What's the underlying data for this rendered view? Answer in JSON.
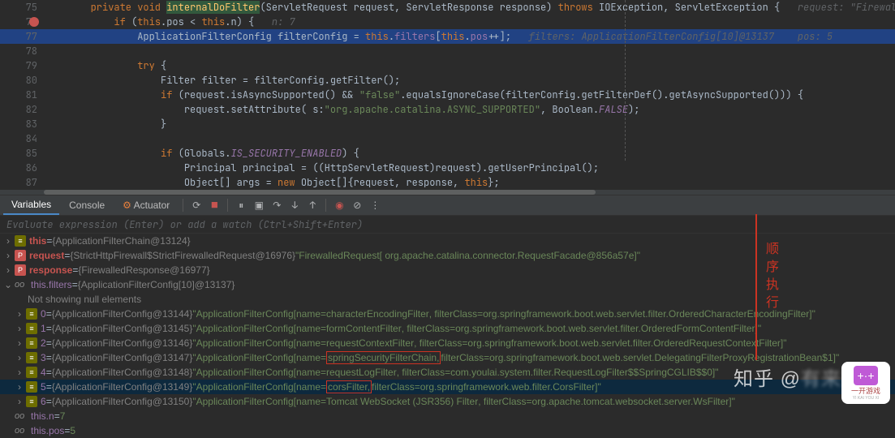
{
  "code": {
    "line75": {
      "num": "75",
      "indent": "        ",
      "kw1": "private void ",
      "method": "internalDoFilter",
      "sig": "(ServletRequest request, ServletResponse response) ",
      "kw2": "throws ",
      "exc": "IOException, ServletException {",
      "hint": "   request: \"FirewalledRequest[ org.apache.catalina.con"
    },
    "line76": {
      "num": "76",
      "indent": "            ",
      "kw": "if ",
      "txt": "(",
      "kw2": "this",
      "txt2": ".pos < ",
      "kw3": "this",
      "txt3": ".n) {",
      "hint": "   n: 7"
    },
    "line77": {
      "num": "77",
      "indent": "                ",
      "txt": "ApplicationFilterConfig filterConfig = ",
      "kw": "this",
      "txt2": ".",
      "field": "filters",
      "txt3": "[",
      "kw2": "this",
      "txt4": ".",
      "field2": "pos",
      "txt5": "++];",
      "hint": "   filters: ApplicationFilterConfig[10]@13137    pos: 5"
    },
    "line78": {
      "num": "78"
    },
    "line79": {
      "num": "79",
      "indent": "                ",
      "kw": "try ",
      "txt": "{"
    },
    "line80": {
      "num": "80",
      "indent": "                    ",
      "txt": "Filter filter = filterConfig.getFilter();"
    },
    "line81": {
      "num": "81",
      "indent": "                    ",
      "kw": "if ",
      "txt": "(request.isAsyncSupported() && ",
      "str": "\"false\"",
      "txt2": ".equalsIgnoreCase(filterConfig.getFilterDef().getAsyncSupported())) {"
    },
    "line82": {
      "num": "82",
      "indent": "                        ",
      "txt": "request.setAttribute( s:",
      "str": "\"org.apache.catalina.ASYNC_SUPPORTED\"",
      "txt2": ", Boolean.",
      "static": "FALSE",
      "txt3": ");"
    },
    "line83": {
      "num": "83",
      "indent": "                    ",
      "txt": "}"
    },
    "line84": {
      "num": "84"
    },
    "line85": {
      "num": "85",
      "indent": "                    ",
      "kw": "if ",
      "txt": "(Globals.",
      "static": "IS_SECURITY_ENABLED",
      "txt2": ") {"
    },
    "line86": {
      "num": "86",
      "indent": "                        ",
      "txt": "Principal principal = ((HttpServletRequest)request).getUserPrincipal();"
    },
    "line87": {
      "num": "87",
      "indent": "                        ",
      "txt": "Object[] args = ",
      "kw": "new ",
      "txt2": "Object[]{request, response, ",
      "kw2": "this",
      "txt3": "};"
    }
  },
  "tabs": {
    "variables": "Variables",
    "console": "Console",
    "actuator": "Actuator"
  },
  "eval_placeholder": "Evaluate expression (Enter) or add a watch (Ctrl+Shift+Enter)",
  "vars": {
    "row_this": {
      "name": "this",
      "eq": " = ",
      "id": "{ApplicationFilterChain@13124}"
    },
    "row_request": {
      "name": "request",
      "eq": " = ",
      "id": "{StrictHttpFirewall$StrictFirewalledRequest@16976}",
      "val": " \"FirewalledRequest[ org.apache.catalina.connector.RequestFacade@856a57e]\""
    },
    "row_response": {
      "name": "response",
      "eq": " = ",
      "id": "{FirewalledResponse@16977}"
    },
    "row_filters": {
      "name": "this.filters",
      "eq": " = ",
      "id": "{ApplicationFilterConfig[10]@13137}"
    },
    "null_note": "Not showing null elements",
    "idx": [
      {
        "i": "0",
        "id": "{ApplicationFilterConfig@13144}",
        "pre": " \"ApplicationFilterConfig[name=",
        "hl": "characterEncodingFilter",
        "post": ", filterClass=org.springframework.boot.web.servlet.filter.OrderedCharacterEncodingFilter]\""
      },
      {
        "i": "1",
        "id": "{ApplicationFilterConfig@13145}",
        "pre": " \"ApplicationFilterConfig[name=",
        "hl": "formContentFilter",
        "post": ", filterClass=org.springframework.boot.web.servlet.filter.OrderedFormContentFilter]\""
      },
      {
        "i": "2",
        "id": "{ApplicationFilterConfig@13146}",
        "pre": " \"ApplicationFilterConfig[name=",
        "hl": "requestContextFilter",
        "post": ", filterClass=org.springframework.boot.web.servlet.filter.OrderedRequestContextFilter]\""
      },
      {
        "i": "3",
        "id": "{ApplicationFilterConfig@13147}",
        "pre": " \"ApplicationFilterConfig[name=",
        "hl": "springSecurityFilterChain,",
        "post": " filterClass=org.springframework.boot.web.servlet.DelegatingFilterProxyRegistrationBean$1]\"",
        "box": true
      },
      {
        "i": "4",
        "id": "{ApplicationFilterConfig@13148}",
        "pre": " \"ApplicationFilterConfig[name=",
        "hl": "requestLogFilter",
        "post": ", filterClass=com.youlai.system.filter.RequestLogFilter$$SpringCGLIB$$0]\""
      },
      {
        "i": "5",
        "id": "{ApplicationFilterConfig@13149}",
        "pre": " \"ApplicationFilterConfig[name=",
        "hl": "corsFilter,",
        "post": " filterClass=org.springframework.web.filter.CorsFilter]\"",
        "box": true,
        "sel": true
      },
      {
        "i": "6",
        "id": "{ApplicationFilterConfig@13150}",
        "pre": " \"ApplicationFilterConfig[name=",
        "hl": "Tomcat WebSocket (JSR356) Filter",
        "post": ", filterClass=org.apache.tomcat.websocket.server.WsFilter]\""
      }
    ],
    "row_n": {
      "name": "this.n",
      "eq": " = ",
      "val": "7"
    },
    "row_pos": {
      "name": "this.pos",
      "eq": " = ",
      "val": "5"
    }
  },
  "annotation": "顺序执行",
  "watermark": {
    "zhihu": "知乎",
    "at": "@",
    "rest": "有来技术"
  },
  "logo": {
    "top": "+·+",
    "text": "一开游戏",
    "sub": "YI KAI YOU XI"
  }
}
